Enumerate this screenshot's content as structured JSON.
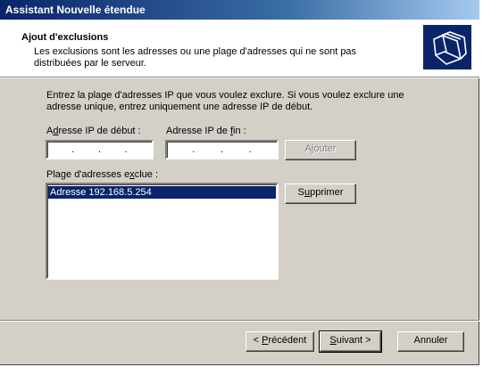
{
  "window": {
    "title": "Assistant Nouvelle étendue"
  },
  "header": {
    "title": "Ajout d'exclusions",
    "description": "Les exclusions sont les adresses ou une plage d'adresses qui ne sont pas distribuées par le serveur.",
    "icon": "folders-icon"
  },
  "instructions": "Entrez la plage d'adresses IP que vous voulez exclure. Si vous voulez exclure une adresse unique, entrez uniquement une adresse IP de début.",
  "start_ip": {
    "label_pre": "A",
    "label_acc": "d",
    "label_post": "resse IP de début :",
    "value": ""
  },
  "end_ip": {
    "label_pre": "Adresse IP de ",
    "label_acc": "f",
    "label_post": "in :",
    "value": ""
  },
  "add_button": {
    "pre": "A",
    "acc": "j",
    "post": "outer"
  },
  "excluded": {
    "label_pre": "Plage d'adresses e",
    "label_acc": "x",
    "label_post": "clue :",
    "items": [
      "Adresse 192.168.5.254"
    ]
  },
  "remove_button": {
    "pre": "S",
    "acc": "u",
    "post": "pprimer"
  },
  "nav": {
    "back": {
      "pre": "< ",
      "acc": "P",
      "post": "récédent"
    },
    "next": {
      "pre": "",
      "acc": "S",
      "post": "uivant >"
    },
    "cancel": "Annuler"
  }
}
